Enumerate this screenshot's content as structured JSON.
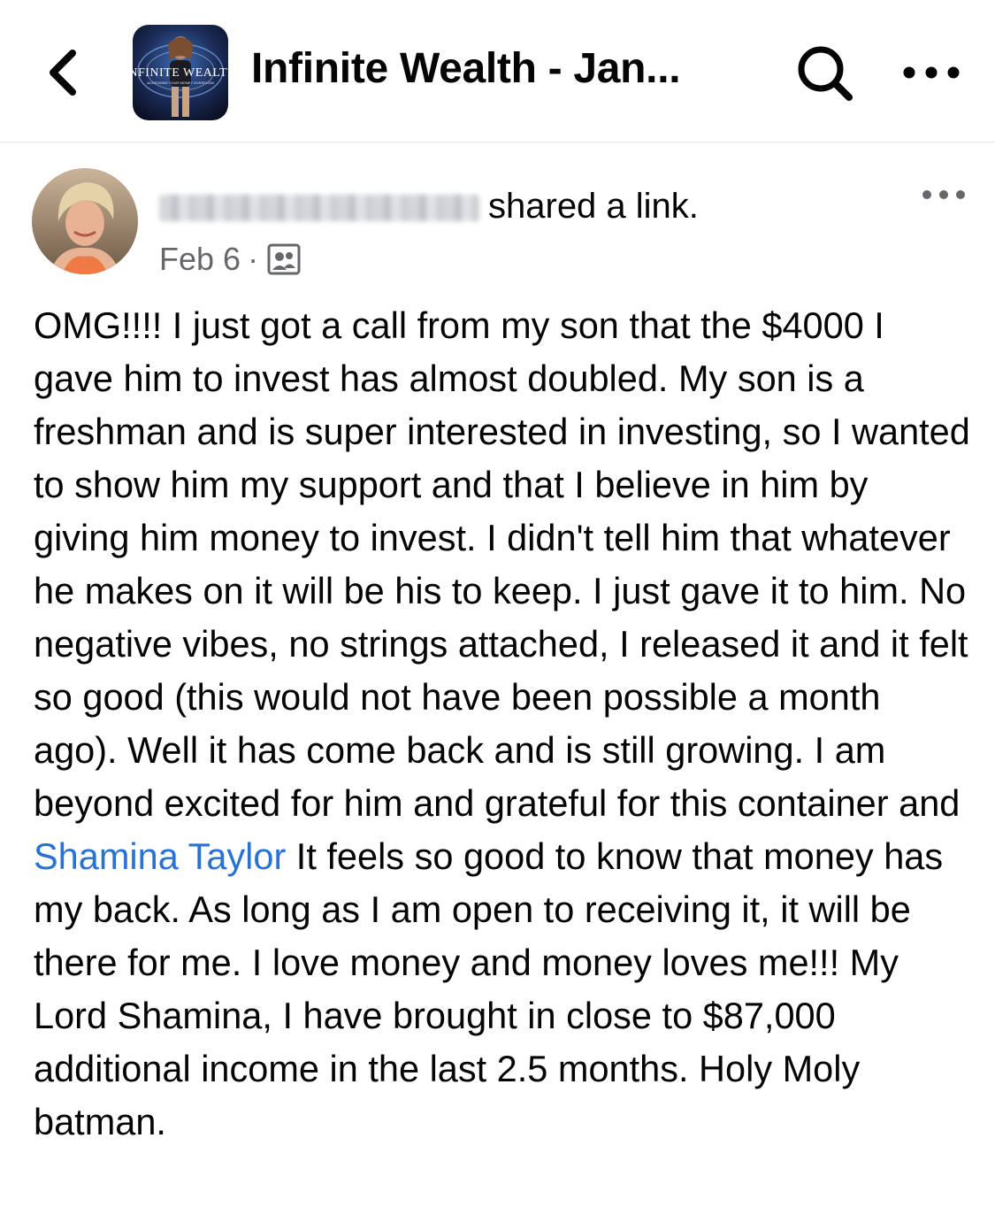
{
  "header": {
    "group_name": "Infinite Wealth - Jan...",
    "group_thumb_text": "INFINITE WEALTH",
    "group_thumb_subtext": "ACCESSING YOUR MONEY OVERFLOW",
    "back_icon": "chevron-left-icon",
    "search_icon": "search-icon",
    "more_icon": "more-horizontal-icon"
  },
  "post": {
    "author_name": "",
    "action_text": "shared a link.",
    "date": "Feb 6",
    "separator": "·",
    "audience_icon": "group-members-icon",
    "more_icon": "more-horizontal-icon",
    "body_part1": "OMG!!!! I just got a call from my son that the $4000 I gave him to invest has almost doubled. My son is a freshman and is super interested in investing, so I wanted to show him my support and that I believe in him by giving him money to invest. I didn't tell him that whatever he makes on it will be his to keep. I just gave it to him. No negative vibes, no strings attached, I released it and it felt so good (this would not have been possible a month ago). Well it has come back and is still growing. I am beyond excited for him and grateful for this container and ",
    "mention": "Shamina Taylor",
    "body_part2": " It feels so good to know that money has my back. As long as I am open to receiving it, it will be there for me. I love money and money loves me!!! My Lord Shamina, I have brought in close to $87,000 additional income in the last 2.5 months. Holy Moly batman."
  },
  "colors": {
    "link": "#2a71d4",
    "secondary_text": "#65676b",
    "divider": "#e4e6eb"
  }
}
